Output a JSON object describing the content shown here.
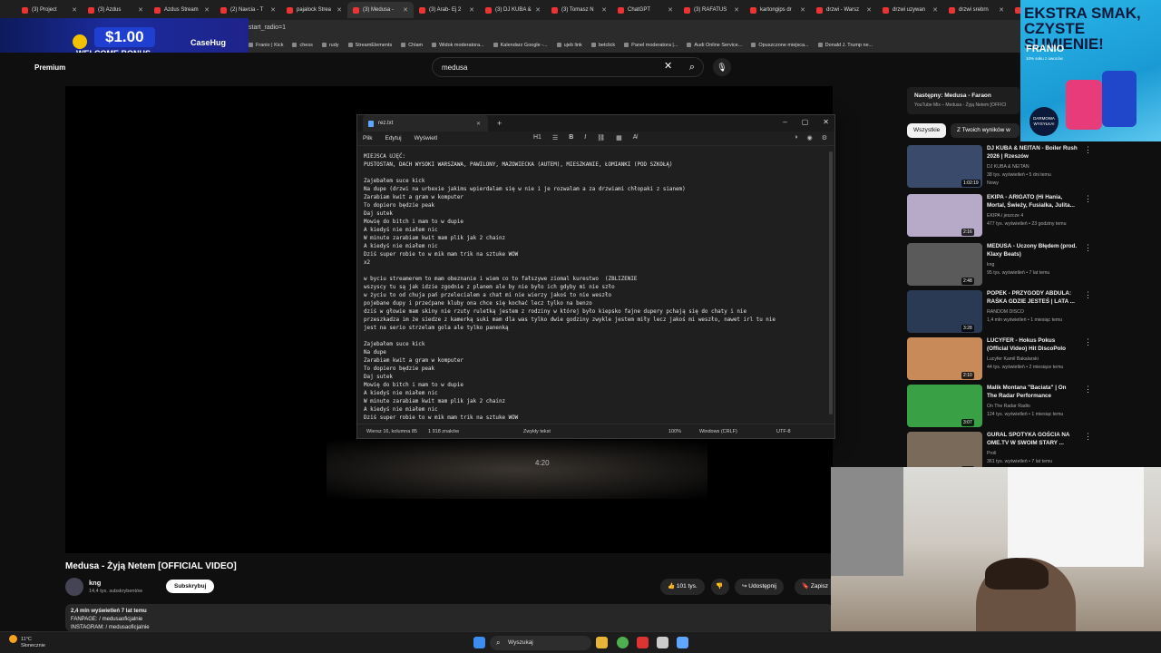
{
  "browser": {
    "tabs": [
      "(3) Project",
      "(3) Azdus",
      "Azdus Stream",
      "(2) Navcia - T",
      "pajalock Strea",
      "(3) Medusa -",
      "(3) Arab- Ej 2",
      "(3) DJ KUBA &",
      "(3) Tomasz N",
      "ChatGPT",
      "(3) RAFATUS",
      "kartongips dr",
      "drzwi - Warsz",
      "drzwi uzywan",
      "drzwi srebrn",
      "pod"
    ],
    "active_tab": "(3) Medusa -",
    "url": "start_radio=1",
    "bookmarks": [
      "Franio | Kick",
      "chess",
      "rudy",
      "StreamElements",
      "Chlam",
      "Widok moderatora...",
      "Kalendarz Google -...",
      "ujeb link",
      "betclick",
      "Panel moderatora |...",
      "Audi Online Service...",
      "Opuszczone miejsca...",
      "Donald J. Trump ne..."
    ]
  },
  "ad_left": {
    "amount": "$1.00",
    "text": "WELCOME BONUS",
    "brand": "CaseHug"
  },
  "youtube": {
    "logo": "Premium",
    "search_value": "medusa",
    "video_title": "Medusa - Żyją Netem [OFFICIAL VIDEO]",
    "channel": "kng",
    "subscribers": "14,4 tys. subskrybentów",
    "subscribe": "Subskrybuj",
    "likes": "101 tys.",
    "share": "Udostępnij",
    "save": "Zapisz",
    "timestamp": "4:20",
    "desc_line1": "2,4 mln wyświetleń  7 lat temu",
    "desc_line2": "FANPAGE: / medusaoficjalnie",
    "desc_line3": "INSTAGRAM: / medusaoficjalnie"
  },
  "notepad": {
    "tab_title": "rez.txt",
    "menu": [
      "Plik",
      "Edytuj",
      "Wyświetl"
    ],
    "heading": "H1",
    "lines": [
      "MIEJSCA UJĘĆ:",
      "PUSTOSTAN, DACH WYSOKI WARSZAWA, PAWILONY, MAZOWIECKA (AUTEM), MIESZKANIE, ŁOMIANKI (POD SZKOŁĄ)",
      "",
      "Zajebałem suce kick",
      "Na dupe (drzwi na urbexie jakims wpierdalam się w nie i je rozwalam a za drzwiami chłopaki z sianem)",
      "Zarabiam kwit a gram w komputer",
      "To dopiero będzie peak",
      "Daj sutek",
      "Mowię do bitch i mam to w dupie",
      "A kiedyś nie miałem nic",
      "W minute zarabiam kwit mam plik jak 2 chainz",
      "A kiedyś nie miałem nic",
      "Dziś super robie to w mik mam trik na sztuke WOW",
      "x2",
      "",
      "w byciu streamerem to mam obeznanie i wiem co to fałszywe ziomal kurestwo  (ZBLIZENIE",
      "wszyscy tu są jak idzie zgodnie z planem ale by nie było ich gdyby mi nie szło",
      "w życiu to od chuja pań przelecialem a chat mi nie wierzy jakoś to nie weszło",
      "pojebane dupy i przećpane kluby ona chce się kochać lecz tylko na benzo",
      "dziś w głowie mam skiny nie rzuty ruletką jestem z rodziny w której było kiepsko fajne dupery pchają się do chaty i nie",
      "przeszkadza im że siedze z kamerką suki mam dla was tylko dwie godziny zwykle jestem miły lecz jakoś mi weszło, nawet irl tu nie",
      "jest na serio strzelam gola ale tylko panenką",
      "",
      "Zajebałem suce kick",
      "Na dupe",
      "Zarabiam kwit a gram w komputer",
      "To dopiero będzie peak",
      "Daj sutek",
      "Mowię do bitch i mam to w dupie",
      "A kiedyś nie miałem nic",
      "W minute zarabiam kwit mam plik jak 2 chainz",
      "A kiedyś nie miałem nic",
      "Dziś super robie to w mik mam trik na sztuke WOW"
    ],
    "status_pos": "Wiersz 16, kolumna 85",
    "status_chars": "1 918 znaków",
    "status_format": "Zwykły tekst",
    "status_zoom": "100%",
    "status_eol": "Windows (CRLF)",
    "status_enc": "UTF-8"
  },
  "sidebar": {
    "upnext_label": "Następny: Medusa - Faraon",
    "upnext_sub": "YouTube Mix – Medusa - Żyją Netem [OFFICI",
    "chip_all": "Wszystkie",
    "chip_other": "Z Twoich wyników w",
    "items": [
      {
        "title": "DJ KUBA & NEITAN - Boiler Rush 2026 | Rzeszów",
        "channel": "DJ KUBA & NEITAN",
        "meta": "38 tys. wyświetleń • 5 dni temu",
        "badge": "Nowy",
        "dur": "1:02:19",
        "color": "#3a4a6a"
      },
      {
        "title": "EKIPA - ARIGATO (Hi Hania, Mortal, Świeży, Fusialka, Julita...",
        "channel": "EKIPA  i jeszcze 4",
        "meta": "477 tys. wyświetleń • 23 godziny temu",
        "badge": "",
        "dur": "2:16",
        "color": "#b7a9c8"
      },
      {
        "title": "MEDUSA - Uczony Błędem (prod. Klaxy Beats)",
        "channel": "kng",
        "meta": "95 tys. wyświetleń • 7 lat temu",
        "badge": "",
        "dur": "2:48",
        "color": "#5a5a5a"
      },
      {
        "title": "POPEK - PRZYGODY ABDULA: RAŚKA GDZIE JESTEŚ | LATA ...",
        "channel": "RANDOM DISCO",
        "meta": "1,4 mln wyświetleń • 1 miesiąc temu",
        "badge": "",
        "dur": "3:28",
        "color": "#2a3a55"
      },
      {
        "title": "LUCYFER - Hokus Pokus (Official Video) Hit DiscoPolo",
        "channel": "Lucyfer Kamil Bakalarski",
        "meta": "44 tys. wyświetleń • 2 miesiące temu",
        "badge": "",
        "dur": "2:10",
        "color": "#c98a5a"
      },
      {
        "title": "Malik Montana \"Baciata\" | On The Radar Performance",
        "channel": "On The Radar Radio",
        "meta": "124 tys. wyświetleń • 1 miesiąc temu",
        "badge": "",
        "dur": "3:07",
        "color": "#3aa045"
      },
      {
        "title": "GURAL SPOTYKA GOŚCIA NA OME.TV W SWOIM STARY ...",
        "channel": "Proli",
        "meta": "361 tys. wyświetleń • 7 lat temu",
        "badge": "",
        "dur": "3:52",
        "color": "#7a6a5a"
      }
    ]
  },
  "ad_right": {
    "headline": "EKSTRA SMAK, CZYSTE SUMIENIE!",
    "brand": "FRANIO",
    "small": "10% soku z owoców",
    "badge": "DARMOWA WYSYŁKA!"
  },
  "taskbar": {
    "temp": "11°C",
    "weather": "Słonecznie",
    "search": "Wyszukaj"
  }
}
